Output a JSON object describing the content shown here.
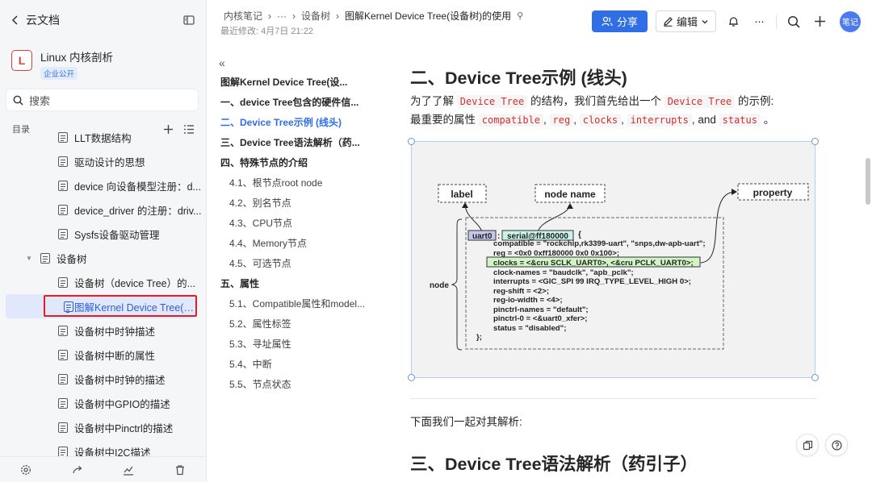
{
  "sidebar": {
    "back_label": "云文档",
    "kb_logo": "L",
    "kb_title": "Linux 内核剖析",
    "kb_badge": "企业公开",
    "search_placeholder": "搜索",
    "toc_label": "目录",
    "tree": [
      {
        "label": "LLT数据结构",
        "level": 2
      },
      {
        "label": "驱动设计的思想",
        "level": 2
      },
      {
        "label": "device 向设备模型注册：d...",
        "level": 2
      },
      {
        "label": "device_driver 的注册：driv...",
        "level": 2
      },
      {
        "label": "Sysfs设备驱动管理",
        "level": 2
      },
      {
        "label": "设备树",
        "level": 1,
        "expanded": true
      },
      {
        "label": "设备树（device Tree）的...",
        "level": 2
      },
      {
        "label": "图解Kernel Device Tree(设...",
        "level": 2,
        "selected": true
      },
      {
        "label": "设备树中时钟描述",
        "level": 2
      },
      {
        "label": "设备树中断的属性",
        "level": 2
      },
      {
        "label": "设备树中时钟的描述",
        "level": 2
      },
      {
        "label": "设备树中GPIO的描述",
        "level": 2
      },
      {
        "label": "设备树中Pinctrl的描述",
        "level": 2
      },
      {
        "label": "设备树中I2C描述",
        "level": 2
      }
    ]
  },
  "header": {
    "crumbs": [
      "内核笔记",
      "···",
      "设备树",
      "图解Kernel Device Tree(设备树)的使用"
    ],
    "pin_glyph": "⚲",
    "modified": "最近修改: 4月7日 21:22",
    "share_label": "分享",
    "edit_label": "编辑",
    "avatar_label": "笔记"
  },
  "outline": {
    "items": [
      {
        "label": "图解Kernel Device Tree(设...",
        "cls": "l1"
      },
      {
        "label": "一、device Tree包含的硬件信...",
        "cls": "l1"
      },
      {
        "label": "二、Device Tree示例 (线头)",
        "cls": "l1 active"
      },
      {
        "label": "三、Device Tree语法解析（药...",
        "cls": "l1"
      },
      {
        "label": "四、特殊节点的介绍",
        "cls": "l1"
      },
      {
        "label": "4.1、根节点root node",
        "cls": "l2"
      },
      {
        "label": "4.2、别名节点",
        "cls": "l2"
      },
      {
        "label": "4.3、CPU节点",
        "cls": "l2"
      },
      {
        "label": "4.4、Memory节点",
        "cls": "l2"
      },
      {
        "label": "4.5、可选节点",
        "cls": "l2"
      },
      {
        "label": "五、属性",
        "cls": "l1"
      },
      {
        "label": "5.1、Compatible属性和model...",
        "cls": "l2"
      },
      {
        "label": "5.2、属性标签",
        "cls": "l2"
      },
      {
        "label": "5.3、寻址属性",
        "cls": "l2"
      },
      {
        "label": "5.4、中断",
        "cls": "l2"
      },
      {
        "label": "5.5、节点状态",
        "cls": "l2"
      }
    ]
  },
  "main": {
    "heading2": "二、Device Tree示例 (线头)",
    "para1_a": "为了了解",
    "para1_code1": "Device Tree",
    "para1_b": "的结构，我们首先给出一个",
    "para1_code2": "Device Tree",
    "para1_c": "的示例:",
    "para2_a": "最重要的属性",
    "codes": [
      "compatible",
      "reg",
      "clocks",
      "interrupts",
      "status"
    ],
    "para2_and": ", and",
    "para2_end": "。",
    "figure": {
      "label_tag": "label",
      "node_name_tag": "node name",
      "property_tag": "property",
      "node_tag": "node",
      "uart_label": "uart0",
      "colon": ":",
      "node_name": "serial@ff180000",
      "open_brace": "{",
      "lines": [
        "compatible = \"rockchip,rk3399-uart\", \"snps,dw-apb-uart\";",
        "reg = <0x0 0xff180000 0x0 0x100>;",
        "clocks = <&cru SCLK_UART0>, <&cru PCLK_UART0>;",
        "clock-names = \"baudclk\", \"apb_pclk\";",
        "interrupts = <GIC_SPI 99 IRQ_TYPE_LEVEL_HIGH 0>;",
        "reg-shift = <2>;",
        "reg-io-width = <4>;",
        "pinctrl-names = \"default\";",
        "pinctrl-0 = <&uart0_xfer>;",
        "status = \"disabled\";"
      ],
      "close": "};"
    },
    "para3": "下面我们一起对其解析:",
    "heading3": "三、Device Tree语法解析（药引子）"
  }
}
